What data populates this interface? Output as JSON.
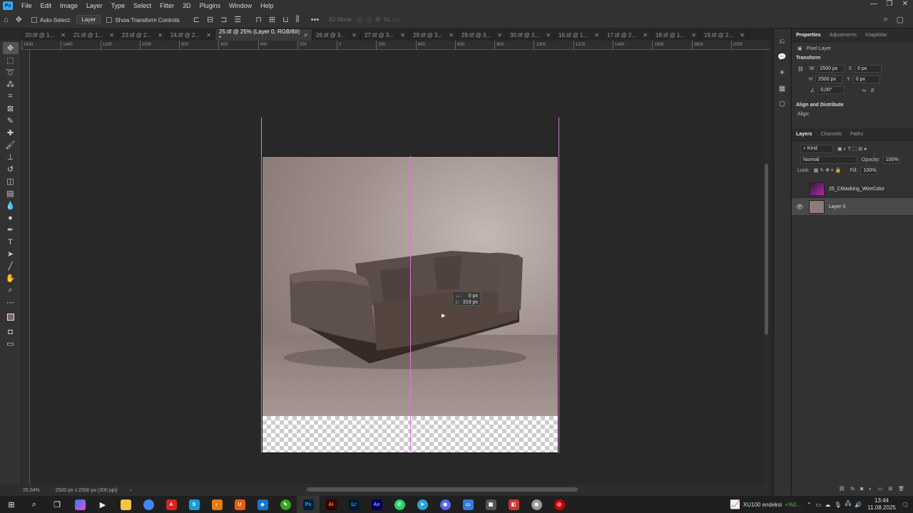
{
  "menubar": {
    "logo": "Ps",
    "items": [
      "File",
      "Edit",
      "Image",
      "Layer",
      "Type",
      "Select",
      "Filter",
      "3D",
      "Plugins",
      "Window",
      "Help"
    ]
  },
  "optionsbar": {
    "auto_select_label": "Auto-Select:",
    "auto_select_value": "Layer",
    "transform_controls_label": "Show Transform Controls",
    "mode_3d_label": "3D Mode:"
  },
  "tabs": [
    {
      "label": "20.tif @ 1..."
    },
    {
      "label": "21.tif @ 1..."
    },
    {
      "label": "23.tif @ 2..."
    },
    {
      "label": "24.tif @ 2..."
    },
    {
      "label": "25.tif @ 25% (Layer 0, RGB/8#) *"
    },
    {
      "label": "26.tif @ 3..."
    },
    {
      "label": "27.tif @ 3..."
    },
    {
      "label": "29.tif @ 3..."
    },
    {
      "label": "29.tif @ 3..."
    },
    {
      "label": "30.tif @ 3..."
    },
    {
      "label": "16.tif @ 1..."
    },
    {
      "label": "17.tif @ 2..."
    },
    {
      "label": "18.tif @ 1..."
    },
    {
      "label": "19.tif @ 2..."
    }
  ],
  "ruler_marks": [
    "1600",
    "1400",
    "1200",
    "1000",
    "800",
    "600",
    "400",
    "200",
    "0",
    "200",
    "400",
    "600",
    "800",
    "1000",
    "1200",
    "1400",
    "1600",
    "1800",
    "2000"
  ],
  "readout": {
    "line1_label": "↔:",
    "line1_value": "0 px",
    "line2_label": "↕:",
    "line2_value": "319 px"
  },
  "status": {
    "zoom": "25,04%",
    "doc_info": "2500 px x 2500 px (300 ppi)"
  },
  "properties": {
    "tabs": [
      "Properties",
      "Adjustments",
      "Kitaplıklar"
    ],
    "layer_type": "Pixel Layer",
    "transform_title": "Transform",
    "w_label": "W",
    "w_value": "2500 px",
    "h_label": "H",
    "h_value": "2500 px",
    "x_label": "X",
    "x_value": "0 px",
    "y_label": "Y",
    "y_value": "0 px",
    "angle_value": "0,00°",
    "align_title": "Align and Distribute",
    "align_label": "Align:"
  },
  "layers_panel": {
    "tabs": [
      "Layers",
      "Channels",
      "Paths"
    ],
    "filter_kind": "Kind",
    "blend_mode": "Normal",
    "opacity_label": "Opacity:",
    "opacity_value": "100%",
    "lock_label": "Lock:",
    "fill_label": "Fill:",
    "fill_value": "100%",
    "layers": [
      {
        "name": "25_CMasking_WireColor",
        "visible": false,
        "selected": false
      },
      {
        "name": "Layer 0",
        "visible": true,
        "selected": true
      }
    ]
  },
  "taskbar": {
    "stock_label": "XU100 endeksi",
    "stock_change": "+%0...",
    "time": "13:44",
    "date": "11.08.2025"
  },
  "colors": {
    "guide": "#d67ad8",
    "ps_blue": "#31a8ff",
    "spotify": "#1db954",
    "chrome": "#4285f4"
  }
}
